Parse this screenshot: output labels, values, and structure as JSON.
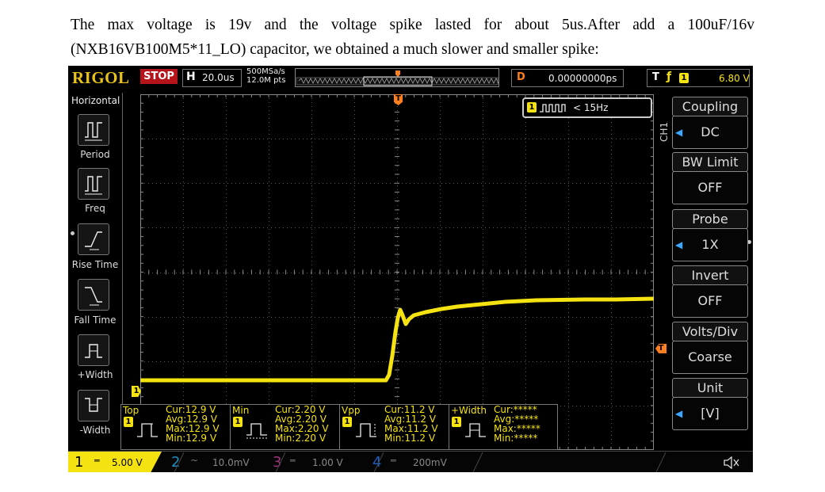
{
  "caption": {
    "line1": "The max voltage is 19v and the voltage spike lasted for about 5us.After add a 100uF/16v",
    "line2": "(NXB16VB100M5*11_LO) capacitor, we obtained a much slower and smaller spike:"
  },
  "topbar": {
    "logo": "RIGOL",
    "run_state": "STOP",
    "h_label": "H",
    "timebase": "20.0us",
    "sample_rate": "500MSa/s",
    "mem_depth": "12.0M pts",
    "delay_label": "D",
    "delay_value": "0.00000000ps",
    "trigger_label": "T",
    "trigger_source": "1",
    "trigger_level": "6.80 V"
  },
  "left_menu": {
    "title": "Horizontal",
    "items": [
      {
        "label": "Period",
        "icon": "period-icon"
      },
      {
        "label": "Freq",
        "icon": "freq-icon"
      },
      {
        "label": "Rise Time",
        "icon": "rise-time-icon"
      },
      {
        "label": "Fall Time",
        "icon": "fall-time-icon"
      },
      {
        "label": "+Width",
        "icon": "pos-width-icon"
      },
      {
        "label": "-Width",
        "icon": "neg-width-icon"
      }
    ]
  },
  "freq_counter": {
    "channel": "1",
    "value": "< 15Hz"
  },
  "channel_tab": "CH1",
  "right_menu": [
    {
      "title": "Coupling",
      "value": "DC"
    },
    {
      "title": "BW Limit",
      "value": "OFF"
    },
    {
      "title": "Probe",
      "value": "1X"
    },
    {
      "title": "Invert",
      "value": "OFF"
    },
    {
      "title": "Volts/Div",
      "value": "Coarse"
    },
    {
      "title": "Unit",
      "value": "[V]"
    }
  ],
  "measurements": [
    {
      "name": "Top",
      "channel": "1",
      "cur": "Cur:12.9 V",
      "avg": "Avg:12.9 V",
      "max": "Max:12.9 V",
      "min": "Min:12.9 V"
    },
    {
      "name": "Min",
      "channel": "1",
      "cur": "Cur:2.20 V",
      "avg": "Avg:2.20 V",
      "max": "Max:2.20 V",
      "min": "Min:2.20 V"
    },
    {
      "name": "Vpp",
      "channel": "1",
      "cur": "Cur:11.2 V",
      "avg": "Avg:11.2 V",
      "max": "Max:11.2 V",
      "min": "Min:11.2 V"
    },
    {
      "name": "+Width",
      "channel": "1",
      "cur": "Cur:*****",
      "avg": "Avg:*****",
      "max": "Max:*****",
      "min": "Min:*****"
    }
  ],
  "channels": [
    {
      "num": "1",
      "scale": "5.00 V",
      "coupling_icon": "dc-coupling-icon",
      "color": "#f5e311"
    },
    {
      "num": "2",
      "scale": "10.0mV",
      "coupling_icon": "ac-coupling-icon",
      "color": "#1f8fbf"
    },
    {
      "num": "3",
      "scale": "1.00 V",
      "coupling_icon": "dc-coupling-icon",
      "color": "#a0357d"
    },
    {
      "num": "4",
      "scale": "200mV",
      "coupling_icon": "dc-coupling-icon",
      "color": "#1f5fbf"
    }
  ],
  "markers": {
    "trigger_pos": "T",
    "ch1_ground": "1",
    "trigger_level": "T"
  },
  "colors": {
    "ch1": "#f5e311",
    "trigger": "#ff7f1e",
    "accent": "#3ea7ff"
  }
}
